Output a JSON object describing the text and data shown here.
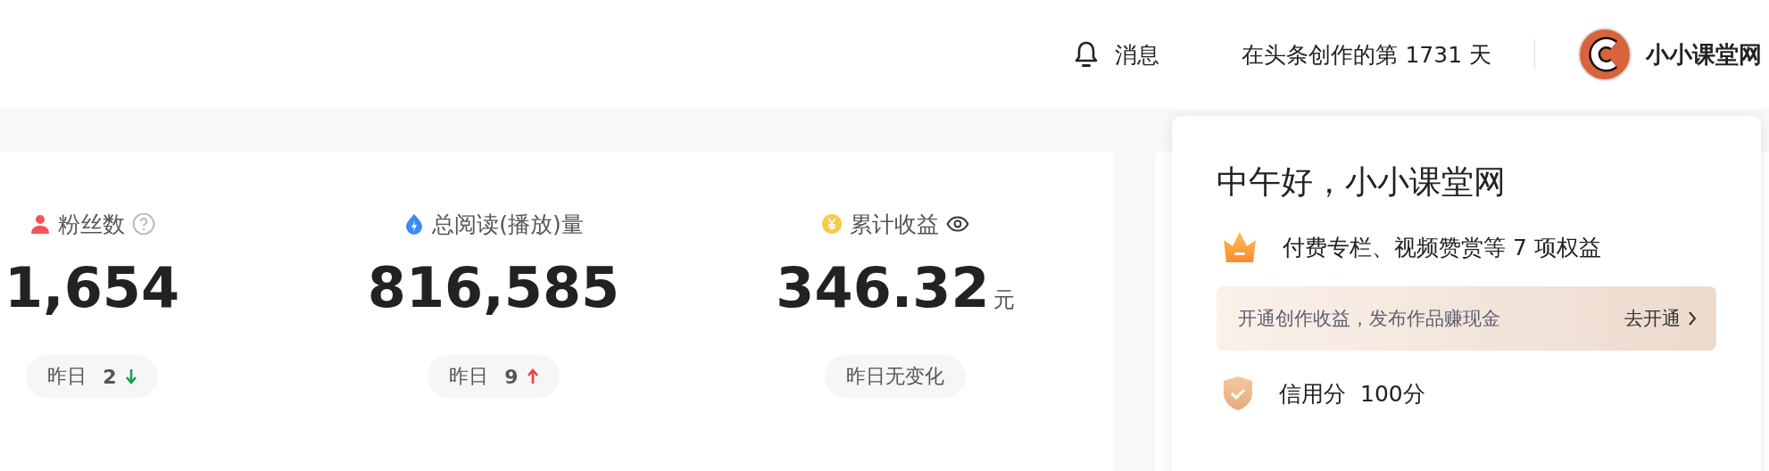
{
  "header": {
    "notifications": "消息",
    "creation_days": "在头条创作的第 1731 天",
    "user_name": "小小课堂网"
  },
  "stats": [
    {
      "kind": "fans",
      "label": "粉丝数",
      "help_icon": true,
      "value": "1,654",
      "change": {
        "label": "昨日",
        "amount": "2",
        "rising": false
      }
    },
    {
      "kind": "reads",
      "label": "总阅读(播放)量",
      "value": "816,585",
      "change": {
        "label": "昨日",
        "amount": "9",
        "rising": true
      }
    },
    {
      "kind": "income",
      "label": "累计收益",
      "visibility_toggle": true,
      "value": "346.32",
      "unit": "元",
      "change": {
        "label": "昨日无变化"
      }
    }
  ],
  "panel": {
    "greeting": "中午好，小小课堂网",
    "benefits": "付费专栏、视频赞赏等 7 项权益",
    "banner": {
      "text": "开通创作收益，发布作品赚现金",
      "action": "去开通"
    },
    "credit": {
      "label": "信用分",
      "score": "100分"
    }
  }
}
